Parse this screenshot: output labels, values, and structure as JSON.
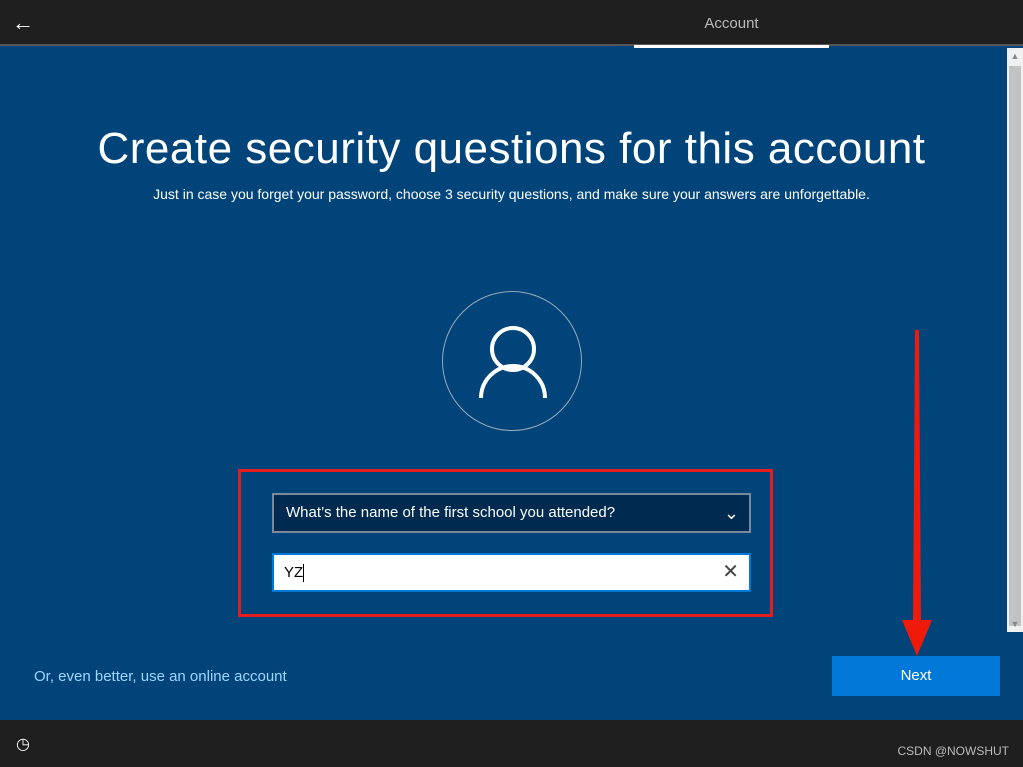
{
  "header": {
    "back_icon": "arrow-left-icon",
    "tab": "Account"
  },
  "main": {
    "title": "Create security questions for this account",
    "subtitle": "Just in case you forget your password, choose 3 security questions, and make sure your answers are unforgettable.",
    "avatar_icon": "user-icon",
    "question": "What’s the name of the first school you attended?",
    "answer": "YZ",
    "link": "Or, even better, use an online account",
    "next": "Next"
  },
  "annotation_color": "#e81c1c",
  "footer": {
    "accessibility_icon": "ease-of-access-icon",
    "watermark": "CSDN @NOWSHUT"
  }
}
